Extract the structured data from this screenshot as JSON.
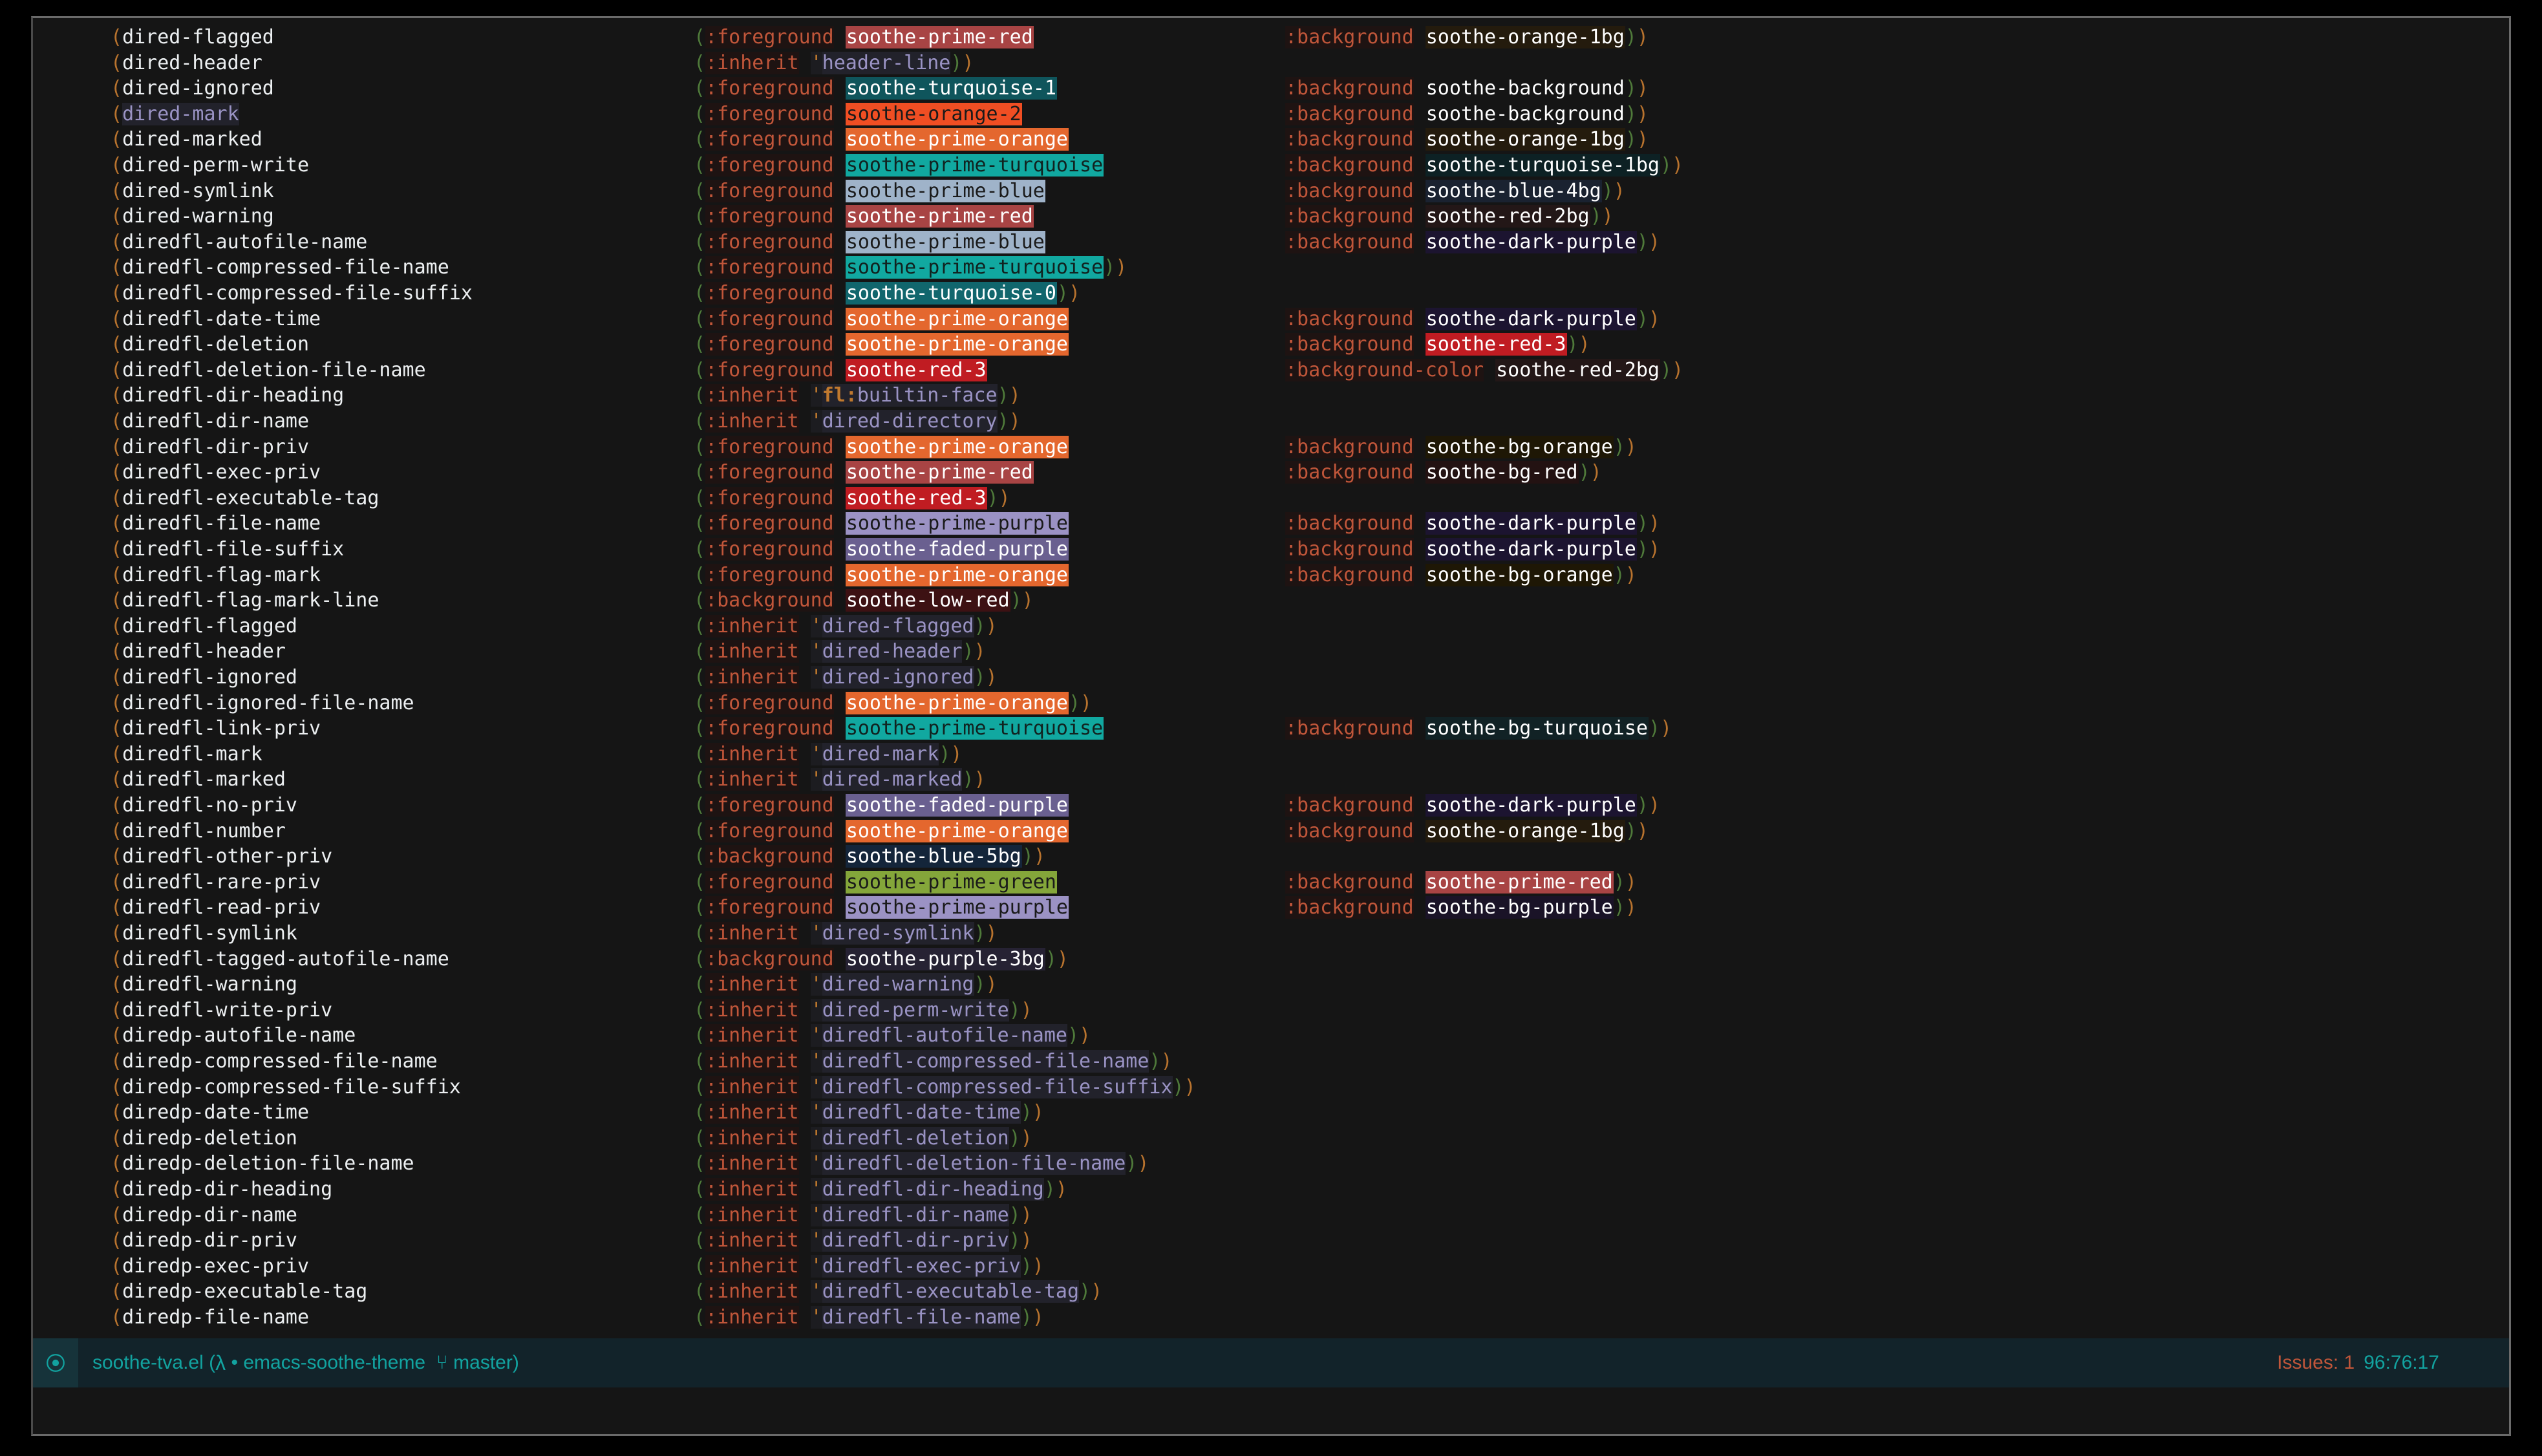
{
  "window": {
    "title": "soothe-tva.el",
    "mode_icon": "record-circle-icon"
  },
  "modeline": {
    "buffer_name": "soothe-tva.el",
    "open_paren": "(",
    "lambda_glyph": "λ",
    "bullet": "•",
    "project": "emacs-soothe-theme",
    "branch_glyph": "⑂",
    "branch": "master",
    "close_paren": ")",
    "issues_label": "Issues: 1",
    "position": "96:76:17",
    "issues_color": "#c0563a",
    "position_color": "#12a3a0",
    "background": "#12232a"
  },
  "palette": {
    "editor_bg": "#151515",
    "keyword": "#c0563a",
    "symbol": "#eceff1",
    "reference": "#9a93c4",
    "quote": "#c0792e",
    "paren_orange": "#b8732e",
    "paren_green": "#4f7a3a"
  },
  "swatches": {
    "soothe-prime-red": {
      "bg": "#a84444",
      "fg": "#ffffff"
    },
    "soothe-turquoise-1": {
      "bg": "#0f555c",
      "fg": "#ffffff"
    },
    "soothe-orange-2": {
      "bg": "#f04e23",
      "fg": "#1a1a1a"
    },
    "soothe-prime-orange": {
      "bg": "#e4672e",
      "fg": "#ffffff"
    },
    "soothe-prime-turquoise": {
      "bg": "#11a8a0",
      "fg": "#11221f"
    },
    "soothe-prime-blue": {
      "bg": "#9fb3c9",
      "fg": "#1a1a1a"
    },
    "soothe-turquoise-0": {
      "bg": "#11666d",
      "fg": "#ffffff"
    },
    "soothe-red-3": {
      "bg": "#c01c22",
      "fg": "#ffffff"
    },
    "soothe-prime-purple": {
      "bg": "#9b92c4",
      "fg": "#1a1a1a"
    },
    "soothe-faded-purple": {
      "bg": "#6a6090",
      "fg": "#ffffff"
    },
    "soothe-low-red": {
      "bg": "#3d1113",
      "fg": "#ffffff"
    },
    "soothe-prime-green": {
      "bg": "#84a63a",
      "fg": "#1a1a1a"
    },
    "soothe-orange-1bg": {
      "bg": "#241b0d",
      "fg": "#ffffff"
    },
    "soothe-background": {
      "bg": "#151515",
      "fg": "#ffffff"
    },
    "soothe-turquoise-1bg": {
      "bg": "#0d2124",
      "fg": "#ffffff"
    },
    "soothe-blue-4bg": {
      "bg": "#1a2230",
      "fg": "#ffffff"
    },
    "soothe-red-2bg": {
      "bg": "#231717",
      "fg": "#ffffff"
    },
    "soothe-dark-purple": {
      "bg": "#1c1430",
      "fg": "#ffffff"
    },
    "soothe-bg-orange": {
      "bg": "#1e1705",
      "fg": "#ffffff"
    },
    "soothe-bg-red": {
      "bg": "#231212",
      "fg": "#ffffff"
    },
    "soothe-bg-turquoise": {
      "bg": "#112225",
      "fg": "#ffffff"
    },
    "soothe-blue-5bg": {
      "bg": "#14253a",
      "fg": "#ffffff"
    },
    "soothe-bg-purple": {
      "bg": "#1a1327",
      "fg": "#ffffff"
    },
    "soothe-purple-3bg": {
      "bg": "#262233",
      "fg": "#ffffff"
    }
  },
  "lines": [
    {
      "face": "dired-flagged",
      "key": ":foreground",
      "val": "soothe-prime-red",
      "val_kind": "swatch",
      "bkey": ":background",
      "bval": "soothe-orange-1bg",
      "bval_kind": "swatch"
    },
    {
      "face": "dired-header",
      "key": ":inherit",
      "val": "header-line",
      "val_kind": "ref"
    },
    {
      "face": "dired-ignored",
      "key": ":foreground",
      "val": "soothe-turquoise-1",
      "val_kind": "swatch",
      "bkey": ":background",
      "bval": "soothe-background",
      "bval_kind": "swatch"
    },
    {
      "face": "dired-mark",
      "face_ref": true,
      "key": ":foreground",
      "val": "soothe-orange-2",
      "val_kind": "swatch",
      "bkey": ":background",
      "bval": "soothe-background",
      "bval_kind": "swatch"
    },
    {
      "face": "dired-marked",
      "key": ":foreground",
      "val": "soothe-prime-orange",
      "val_kind": "swatch",
      "bkey": ":background",
      "bval": "soothe-orange-1bg",
      "bval_kind": "swatch"
    },
    {
      "face": "dired-perm-write",
      "key": ":foreground",
      "val": "soothe-prime-turquoise",
      "val_kind": "swatch",
      "bkey": ":background",
      "bval": "soothe-turquoise-1bg",
      "bval_kind": "swatch"
    },
    {
      "face": "dired-symlink",
      "key": ":foreground",
      "val": "soothe-prime-blue",
      "val_kind": "swatch",
      "bkey": ":background",
      "bval": "soothe-blue-4bg",
      "bval_kind": "swatch"
    },
    {
      "face": "dired-warning",
      "key": ":foreground",
      "val": "soothe-prime-red",
      "val_kind": "swatch",
      "bkey": ":background",
      "bval": "soothe-red-2bg",
      "bval_kind": "swatch"
    },
    {
      "face": "diredfl-autofile-name",
      "key": ":foreground",
      "val": "soothe-prime-blue",
      "val_kind": "swatch",
      "bkey": ":background",
      "bval": "soothe-dark-purple",
      "bval_kind": "swatch"
    },
    {
      "face": "diredfl-compressed-file-name",
      "key": ":foreground",
      "val": "soothe-prime-turquoise",
      "val_kind": "swatch"
    },
    {
      "face": "diredfl-compressed-file-suffix",
      "key": ":foreground",
      "val": "soothe-turquoise-0",
      "val_kind": "swatch"
    },
    {
      "face": "diredfl-date-time",
      "key": ":foreground",
      "val": "soothe-prime-orange",
      "val_kind": "swatch",
      "bkey": ":background",
      "bval": "soothe-dark-purple",
      "bval_kind": "swatch"
    },
    {
      "face": "diredfl-deletion",
      "key": ":foreground",
      "val": "soothe-prime-orange",
      "val_kind": "swatch",
      "bkey": ":background",
      "bval": "soothe-red-3",
      "bval_kind": "swatch"
    },
    {
      "face": "diredfl-deletion-file-name",
      "key": ":foreground",
      "val": "soothe-red-3",
      "val_kind": "swatch",
      "bkey": ":background-color",
      "bval": "soothe-red-2bg",
      "bval_kind": "swatch"
    },
    {
      "face": "diredfl-dir-heading",
      "key": ":inherit",
      "val": "fl:builtin-face",
      "val_kind": "ref",
      "bold_prefix": "fl:"
    },
    {
      "face": "diredfl-dir-name",
      "key": ":inherit",
      "val": "dired-directory",
      "val_kind": "ref"
    },
    {
      "face": "diredfl-dir-priv",
      "key": ":foreground",
      "val": "soothe-prime-orange",
      "val_kind": "swatch",
      "bkey": ":background",
      "bval": "soothe-bg-orange",
      "bval_kind": "swatch"
    },
    {
      "face": "diredfl-exec-priv",
      "key": ":foreground",
      "val": "soothe-prime-red",
      "val_kind": "swatch",
      "bkey": ":background",
      "bval": "soothe-bg-red",
      "bval_kind": "swatch"
    },
    {
      "face": "diredfl-executable-tag",
      "key": ":foreground",
      "val": "soothe-red-3",
      "val_kind": "swatch"
    },
    {
      "face": "diredfl-file-name",
      "key": ":foreground",
      "val": "soothe-prime-purple",
      "val_kind": "swatch",
      "bkey": ":background",
      "bval": "soothe-dark-purple",
      "bval_kind": "swatch"
    },
    {
      "face": "diredfl-file-suffix",
      "key": ":foreground",
      "val": "soothe-faded-purple",
      "val_kind": "swatch",
      "bkey": ":background",
      "bval": "soothe-dark-purple",
      "bval_kind": "swatch"
    },
    {
      "face": "diredfl-flag-mark",
      "key": ":foreground",
      "val": "soothe-prime-orange",
      "val_kind": "swatch",
      "bkey": ":background",
      "bval": "soothe-bg-orange",
      "bval_kind": "swatch"
    },
    {
      "face": "diredfl-flag-mark-line",
      "key": ":background",
      "val": "soothe-low-red",
      "val_kind": "swatch"
    },
    {
      "face": "diredfl-flagged",
      "key": ":inherit",
      "val": "dired-flagged",
      "val_kind": "ref"
    },
    {
      "face": "diredfl-header",
      "key": ":inherit",
      "val": "dired-header",
      "val_kind": "ref"
    },
    {
      "face": "diredfl-ignored",
      "key": ":inherit",
      "val": "dired-ignored",
      "val_kind": "ref"
    },
    {
      "face": "diredfl-ignored-file-name",
      "key": ":foreground",
      "val": "soothe-prime-orange",
      "val_kind": "swatch"
    },
    {
      "face": "diredfl-link-priv",
      "key": ":foreground",
      "val": "soothe-prime-turquoise",
      "val_kind": "swatch",
      "bkey": ":background",
      "bval": "soothe-bg-turquoise",
      "bval_kind": "swatch"
    },
    {
      "face": "diredfl-mark",
      "key": ":inherit",
      "val": "dired-mark",
      "val_kind": "ref"
    },
    {
      "face": "diredfl-marked",
      "key": ":inherit",
      "val": "dired-marked",
      "val_kind": "ref"
    },
    {
      "face": "diredfl-no-priv",
      "key": ":foreground",
      "val": "soothe-faded-purple",
      "val_kind": "swatch",
      "bkey": ":background",
      "bval": "soothe-dark-purple",
      "bval_kind": "swatch"
    },
    {
      "face": "diredfl-number",
      "key": ":foreground",
      "val": "soothe-prime-orange",
      "val_kind": "swatch",
      "bkey": ":background",
      "bval": "soothe-orange-1bg",
      "bval_kind": "swatch"
    },
    {
      "face": "diredfl-other-priv",
      "key": ":background",
      "val": "soothe-blue-5bg",
      "val_kind": "swatch"
    },
    {
      "face": "diredfl-rare-priv",
      "key": ":foreground",
      "val": "soothe-prime-green",
      "val_kind": "swatch",
      "bkey": ":background",
      "bval": "soothe-prime-red",
      "bval_kind": "swatch"
    },
    {
      "face": "diredfl-read-priv",
      "key": ":foreground",
      "val": "soothe-prime-purple",
      "val_kind": "swatch",
      "bkey": ":background",
      "bval": "soothe-bg-purple",
      "bval_kind": "swatch"
    },
    {
      "face": "diredfl-symlink",
      "key": ":inherit",
      "val": "dired-symlink",
      "val_kind": "ref"
    },
    {
      "face": "diredfl-tagged-autofile-name",
      "key": ":background",
      "val": "soothe-purple-3bg",
      "val_kind": "swatch"
    },
    {
      "face": "diredfl-warning",
      "key": ":inherit",
      "val": "dired-warning",
      "val_kind": "ref"
    },
    {
      "face": "diredfl-write-priv",
      "key": ":inherit",
      "val": "dired-perm-write",
      "val_kind": "ref"
    },
    {
      "face": "diredp-autofile-name",
      "key": ":inherit",
      "val": "diredfl-autofile-name",
      "val_kind": "ref"
    },
    {
      "face": "diredp-compressed-file-name",
      "key": ":inherit",
      "val": "diredfl-compressed-file-name",
      "val_kind": "ref"
    },
    {
      "face": "diredp-compressed-file-suffix",
      "key": ":inherit",
      "val": "diredfl-compressed-file-suffix",
      "val_kind": "ref"
    },
    {
      "face": "diredp-date-time",
      "key": ":inherit",
      "val": "diredfl-date-time",
      "val_kind": "ref"
    },
    {
      "face": "diredp-deletion",
      "key": ":inherit",
      "val": "diredfl-deletion",
      "val_kind": "ref"
    },
    {
      "face": "diredp-deletion-file-name",
      "key": ":inherit",
      "val": "diredfl-deletion-file-name",
      "val_kind": "ref"
    },
    {
      "face": "diredp-dir-heading",
      "key": ":inherit",
      "val": "diredfl-dir-heading",
      "val_kind": "ref"
    },
    {
      "face": "diredp-dir-name",
      "key": ":inherit",
      "val": "diredfl-dir-name",
      "val_kind": "ref"
    },
    {
      "face": "diredp-dir-priv",
      "key": ":inherit",
      "val": "diredfl-dir-priv",
      "val_kind": "ref"
    },
    {
      "face": "diredp-exec-priv",
      "key": ":inherit",
      "val": "diredfl-exec-priv",
      "val_kind": "ref"
    },
    {
      "face": "diredp-executable-tag",
      "key": ":inherit",
      "val": "diredfl-executable-tag",
      "val_kind": "ref"
    },
    {
      "face": "diredp-file-name",
      "key": ":inherit",
      "val": "diredfl-file-name",
      "val_kind": "ref"
    }
  ]
}
